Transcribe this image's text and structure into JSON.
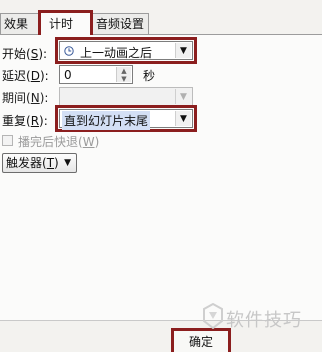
{
  "tabs": [
    {
      "label": "效果"
    },
    {
      "label": "计时"
    },
    {
      "label": "音频设置"
    }
  ],
  "form": {
    "start": {
      "label": "开始",
      "key": "S",
      "value": "上一动画之后"
    },
    "delay": {
      "label": "延迟",
      "key": "D",
      "value": "0",
      "unit": "秒"
    },
    "duration": {
      "label": "期间",
      "key": "N",
      "value": ""
    },
    "repeat": {
      "label": "重复",
      "key": "R",
      "value": "直到幻灯片末尾"
    },
    "rewind": {
      "label": "播完后快退",
      "key": "W",
      "checked": false
    },
    "trigger": {
      "label": "触发器",
      "key": "T"
    }
  },
  "footer": {
    "ok_label": "确定"
  },
  "watermark": {
    "text": "软件技巧"
  },
  "colors": {
    "highlight": "#8b1e1e",
    "selection": "#d3dff5"
  }
}
